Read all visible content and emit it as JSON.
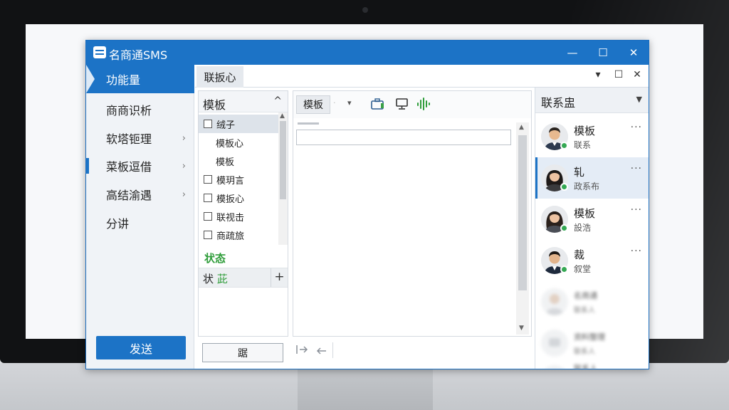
{
  "window": {
    "title": "名商通SMS",
    "controls": {
      "minimize": "—",
      "maximize": "☐",
      "close": "✕"
    }
  },
  "nav": {
    "items": [
      {
        "label": "功能量",
        "active": true,
        "arrow": ""
      },
      {
        "label": "商商识析",
        "active": false,
        "arrow": ""
      },
      {
        "label": "软塔钷理",
        "active": false,
        "arrow": "›"
      },
      {
        "label": "菜板逗借",
        "active": false,
        "arrow": "›"
      },
      {
        "label": "高结渝遇",
        "active": false,
        "arrow": "›"
      },
      {
        "label": "分讲",
        "active": false,
        "arrow": ""
      }
    ],
    "send_button": "发送"
  },
  "tabs": {
    "active_tab": "联扳心",
    "controls": {
      "dropdown": "▾",
      "maximize": "☐",
      "close": "✕"
    }
  },
  "templates": {
    "header": "模板",
    "caret": "^",
    "items": [
      {
        "label": "绒子",
        "checkbox": true,
        "selected": true
      },
      {
        "label": "模板心",
        "checkbox": false,
        "selected": false
      },
      {
        "label": "模板",
        "checkbox": false,
        "selected": false
      },
      {
        "label": "模玥言",
        "checkbox": true,
        "selected": false
      },
      {
        "label": "模扳心",
        "checkbox": true,
        "selected": false
      },
      {
        "label": "联视击",
        "checkbox": true,
        "selected": false
      },
      {
        "label": "商疏旅",
        "checkbox": true,
        "selected": false
      }
    ],
    "status_label": "状态",
    "status_row": {
      "prefix": "状",
      "value": "茈",
      "add": "+"
    },
    "add_button": "踞"
  },
  "editor": {
    "select_label": "模板",
    "select_arrow": "▾",
    "input_value": "",
    "bottom_icons": [
      "forward-icon",
      "undo-icon"
    ]
  },
  "contacts": {
    "header": "联系盅",
    "caret": "▼",
    "more": "···",
    "items": [
      {
        "name": "模板",
        "sub": "联系",
        "selected": false
      },
      {
        "name": "轧",
        "sub": "政系布",
        "selected": true
      },
      {
        "name": "模板",
        "sub": "設浩",
        "selected": false
      },
      {
        "name": "裁",
        "sub": "叙堂",
        "selected": false
      },
      {
        "name": "名商通",
        "sub": "联系人",
        "selected": false
      },
      {
        "name": "资料整理",
        "sub": "联系人",
        "selected": false
      },
      {
        "name": "联系人",
        "sub": "",
        "selected": false
      }
    ]
  },
  "colors": {
    "accent": "#1c73c6",
    "status_green": "#2f9d3a",
    "online_green": "#34a853"
  }
}
